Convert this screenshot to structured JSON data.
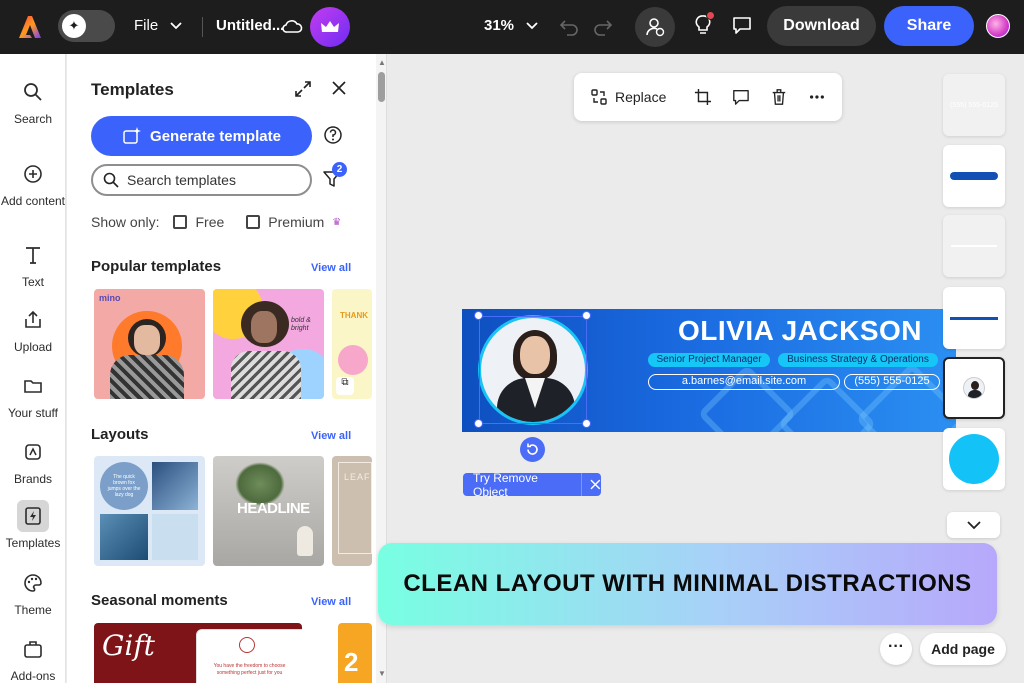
{
  "topbar": {
    "file_label": "File",
    "doc_title": "Untitled...",
    "zoom": "31%",
    "download_label": "Download",
    "share_label": "Share"
  },
  "rail": {
    "items": [
      {
        "label": "Search",
        "icon": "search-icon"
      },
      {
        "label": "Add content",
        "icon": "plus-circle-icon"
      },
      {
        "label": "Text",
        "icon": "text-icon"
      },
      {
        "label": "Upload",
        "icon": "upload-icon"
      },
      {
        "label": "Your stuff",
        "icon": "folder-icon"
      },
      {
        "label": "Brands",
        "icon": "brand-icon"
      },
      {
        "label": "Templates",
        "icon": "templates-icon"
      },
      {
        "label": "Theme",
        "icon": "palette-icon"
      },
      {
        "label": "Add-ons",
        "icon": "addons-icon"
      }
    ]
  },
  "panel": {
    "title": "Templates",
    "generate_label": "Generate template",
    "search_placeholder": "Search templates",
    "filter_count": "2",
    "show_only": "Show only:",
    "free_label": "Free",
    "premium_label": "Premium",
    "sections": {
      "popular": "Popular templates",
      "layouts": "Layouts",
      "seasonal": "Seasonal moments"
    },
    "view_all": "View all",
    "thumb_text": {
      "mino": "mino",
      "bold": "bold & bright",
      "thank": "THANK",
      "quick_brown": "The quick brown fox jumps over the lazy dog",
      "headline": "HEADLINE",
      "leaf": "LEAF",
      "gift": "Gift",
      "gift_note": "You have the freedom to choose something perfect just for you",
      "two": "2"
    }
  },
  "canvas": {
    "replace_label": "Replace",
    "banner": {
      "name": "OLIVIA JACKSON",
      "role": "Senior Project Manager",
      "dept": "Business Strategy & Operations",
      "email": "a.barnes@email.site.com",
      "phone": "(555) 555-0125"
    },
    "remove_object_label": "Try Remove Object",
    "strip_phone": "(555) 555-0125"
  },
  "promo_text": "CLEAN LAYOUT WITH MINIMAL DISTRACTIONS",
  "add_page_label": "Add page",
  "colors": {
    "accent": "#3b63fb",
    "topbar": "#1d1d1d",
    "banner_blue": "#1a6ae0",
    "cyan": "#16c6f7"
  }
}
